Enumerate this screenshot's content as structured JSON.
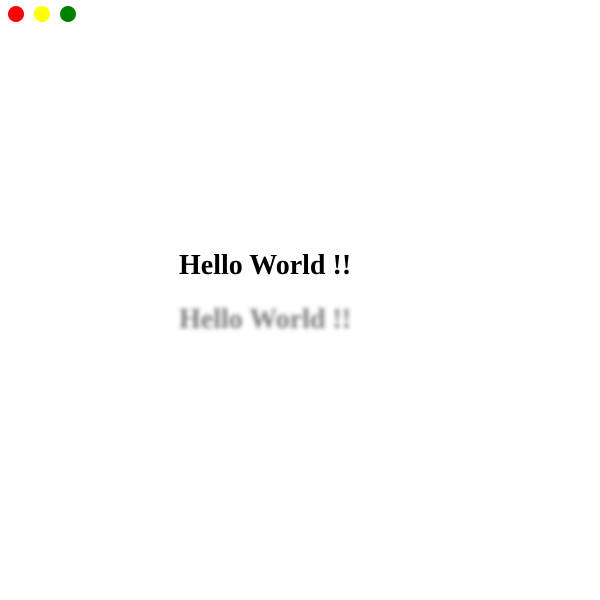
{
  "window": {
    "controls": {
      "close_color": "#ff0000",
      "minimize_color": "#ffff00",
      "maximize_color": "#008000",
      "close_icon": "red-dot-icon",
      "minimize_icon": "yellow-dot-icon",
      "maximize_icon": "green-dot-icon"
    }
  },
  "main": {
    "heading": "Hello World !!",
    "blurred_heading": "Hello World !!"
  }
}
